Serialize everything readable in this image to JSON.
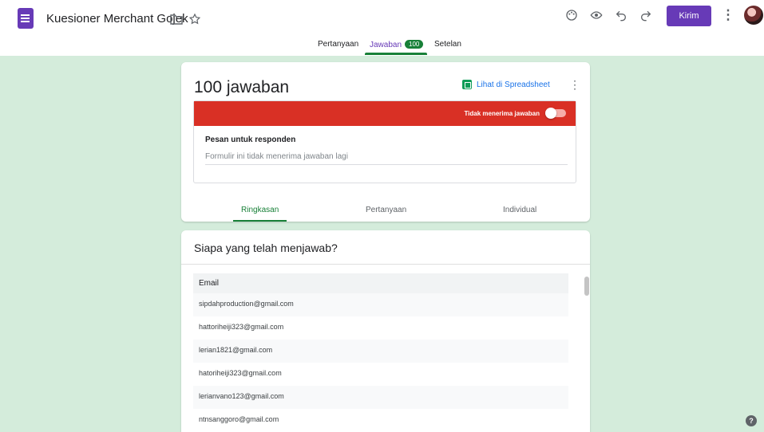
{
  "header": {
    "title": "Kuesioner Merchant Gojek",
    "send_label": "Kirim"
  },
  "tabs": [
    {
      "label": "Pertanyaan"
    },
    {
      "label": "Jawaban",
      "badge": "100"
    },
    {
      "label": "Setelan"
    }
  ],
  "summary": {
    "response_count": "100 jawaban",
    "sheet_link": "Lihat di Spreadsheet",
    "closed_label": "Tidak menerima jawaban",
    "accepting": false,
    "message_label": "Pesan untuk responden",
    "message_value": "Formulir ini tidak menerima jawaban lagi"
  },
  "subtabs": [
    {
      "label": "Ringkasan"
    },
    {
      "label": "Pertanyaan"
    },
    {
      "label": "Individual"
    }
  ],
  "who": {
    "title": "Siapa yang telah menjawab?",
    "column": "Email",
    "emails": [
      "sipdahproduction@gmail.com",
      "hattoriheiji323@gmail.com",
      "lerian1821@gmail.com",
      "hatoriheiji323@gmail.com",
      "lerianvano123@gmail.com",
      "ntnsanggoro@gmail.com"
    ]
  },
  "colors": {
    "accent": "#673ab7",
    "responses_green": "#188038",
    "closed_red": "#d93025",
    "background": "#d4ecdb"
  },
  "icons": {
    "help": "?"
  }
}
